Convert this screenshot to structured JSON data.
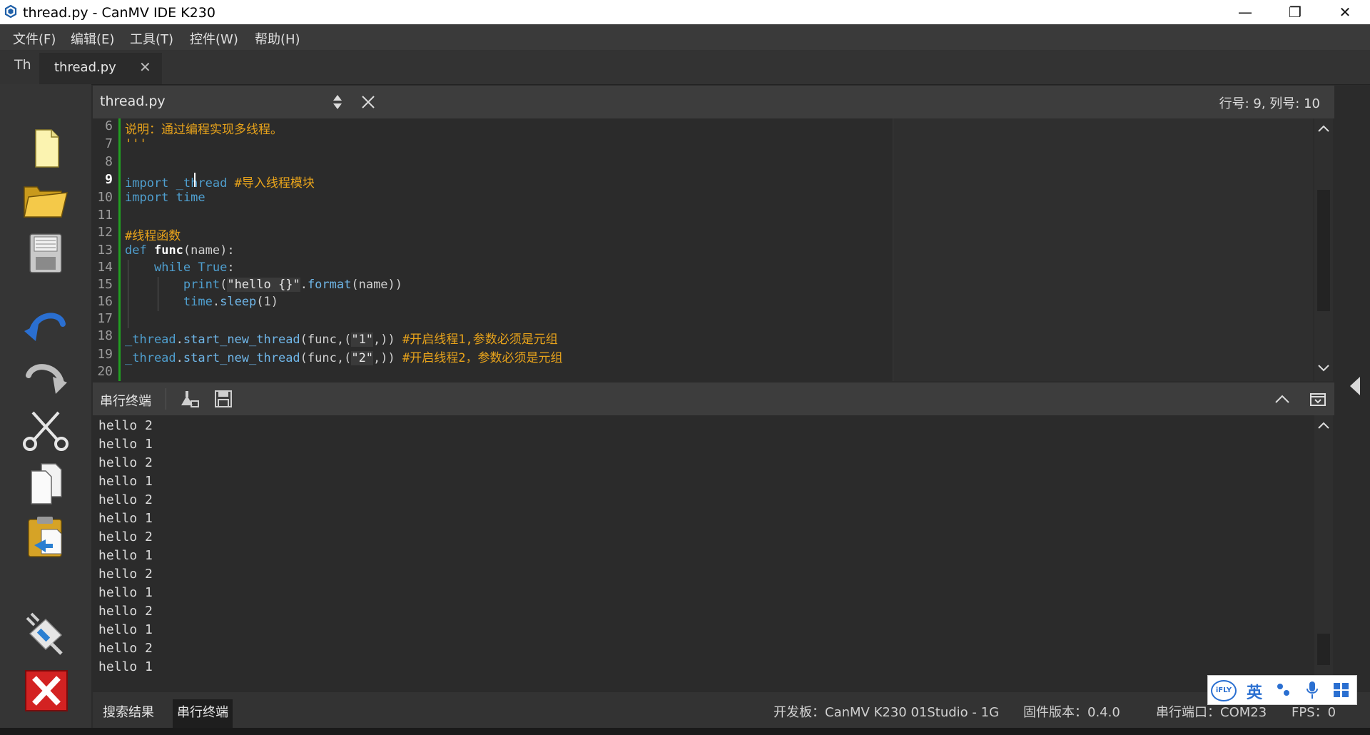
{
  "window": {
    "title": "thread.py - CanMV IDE K230",
    "minimize": "—",
    "restore": "❐",
    "close": "✕"
  },
  "menu": [
    "文件(F)",
    "编辑(E)",
    "工具(T)",
    "控件(W)",
    "帮助(H)"
  ],
  "tabs": {
    "th_icon": "Th",
    "active": "thread.py",
    "close": "✕"
  },
  "editor": {
    "filename": "thread.py",
    "cursor_position": "行号: 9, 列号: 10",
    "line_numbers": [
      "6",
      "7",
      "8",
      "9",
      "10",
      "11",
      "12",
      "13",
      "14",
      "15",
      "16",
      "17",
      "18",
      "19",
      "20"
    ],
    "current_line": "9",
    "code": {
      "l6": "说明：通过编程实现多线程。",
      "l7": "'''",
      "l9_kw": "import",
      "l9_mod": "_thread",
      "l9_cm": "#导入线程模块",
      "l10_kw": "import",
      "l10_mod": "time",
      "l12_cm": "#线程函数",
      "l13_kw": "def",
      "l13_fn": "func",
      "l13_rest": "(name):",
      "l14_kw": "while",
      "l14_kw2": "True",
      "l14_rest": ":",
      "l15_fn": "print",
      "l15_p1": "(",
      "l15_str": "\"hello {}\"",
      "l15_dot": ".",
      "l15_m": "format",
      "l15_rest": "(name))",
      "l16_mod": "time",
      "l16_dot": ".",
      "l16_m": "sleep",
      "l16_rest": "(1)",
      "l18_mod": "_thread",
      "l18_dot": ".",
      "l18_m": "start_new_thread",
      "l18_a": "(func,(",
      "l18_str": "\"1\"",
      "l18_b": ",)) ",
      "l18_cm": "#开启线程1,参数必须是元组",
      "l19_mod": "_thread",
      "l19_dot": ".",
      "l19_m": "start_new_thread",
      "l19_a": "(func,(",
      "l19_str": "\"2\"",
      "l19_b": ",)) ",
      "l19_cm": "#开启线程2，参数必须是元组"
    }
  },
  "terminal": {
    "title": "串行终端",
    "lines": [
      "hello 2",
      "hello 1",
      "hello 2",
      "hello 1",
      "hello 2",
      "hello 1",
      "hello 2",
      "hello 1",
      "hello 2",
      "hello 1",
      "hello 2",
      "hello 1",
      "hello 2",
      "hello 1"
    ]
  },
  "statusbar": {
    "tab_search": "搜索结果",
    "tab_serial": "串行终端",
    "board": "开发板：CanMV K230 01Studio - 1G",
    "firmware": "固件版本：0.4.0",
    "port": "串行端口：COM23",
    "fps": "FPS：0"
  },
  "ime": {
    "lang": "英",
    "logo": "iFLY"
  },
  "colors": {
    "keyword": "#4f9fcf",
    "comment": "#e8a31b",
    "gutter_marker": "#21a021"
  }
}
